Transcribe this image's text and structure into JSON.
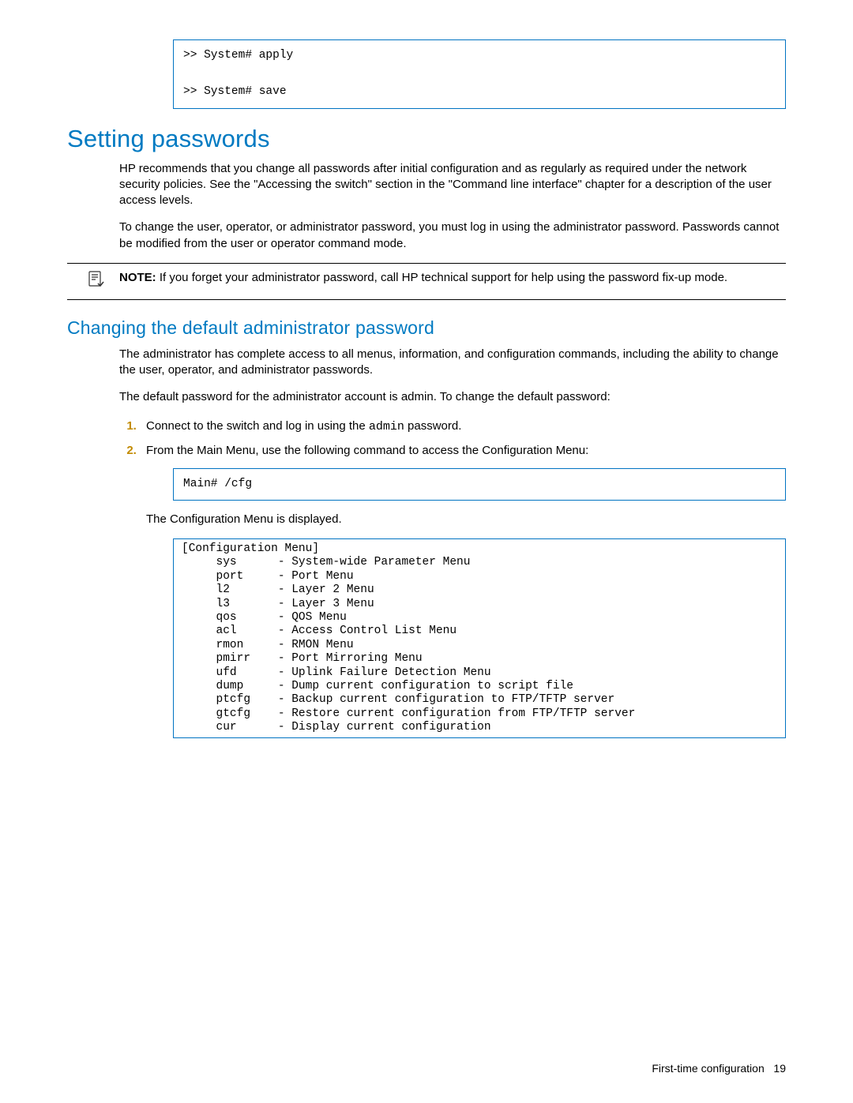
{
  "code1": ">> System# apply\n\n>> System# save",
  "h1": "Setting passwords",
  "p1": "HP recommends that you change all passwords after initial configuration and as regularly as required under the network security policies. See the \"Accessing the switch\" section in the \"Command line interface\" chapter for a description of the user access levels.",
  "p2": "To change the user, operator, or administrator password, you must log in using the administrator password. Passwords cannot be modified from the user or operator command mode.",
  "note_label": "NOTE:",
  "note_body": " If you forget your administrator password, call HP technical support for help using the password fix-up mode.",
  "h2": "Changing the default administrator password",
  "p3": "The administrator has complete access to all menus, information, and configuration commands, including the ability to change the user, operator, and administrator passwords.",
  "p4": "The default password for the administrator account is admin. To change the default password:",
  "step1_a": "Connect to the switch and log in using the ",
  "step1_code": "admin",
  "step1_b": " password.",
  "step2": "From the Main Menu, use the following command to access the Configuration Menu:",
  "code2": "Main# /cfg",
  "p5": "The Configuration Menu is displayed.",
  "code3": "[Configuration Menu]\n     sys      - System-wide Parameter Menu\n     port     - Port Menu\n     l2       - Layer 2 Menu\n     l3       - Layer 3 Menu\n     qos      - QOS Menu\n     acl      - Access Control List Menu\n     rmon     - RMON Menu\n     pmirr    - Port Mirroring Menu\n     ufd      - Uplink Failure Detection Menu\n     dump     - Dump current configuration to script file\n     ptcfg    - Backup current configuration to FTP/TFTP server\n     gtcfg    - Restore current configuration from FTP/TFTP server\n     cur      - Display current configuration",
  "footer_section": "First-time configuration",
  "footer_page": "19"
}
